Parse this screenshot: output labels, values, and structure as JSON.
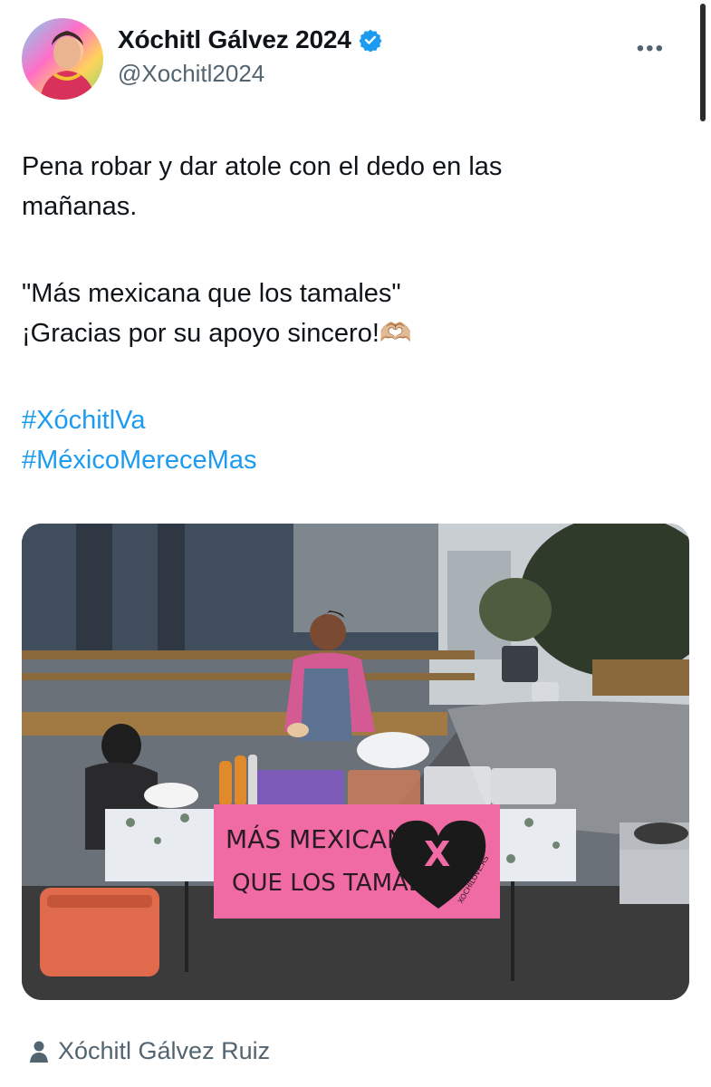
{
  "post": {
    "display_name": "Xóchitl Gálvez 2024",
    "handle": "@Xochitl2024",
    "more_icon": "more-icon",
    "verified_color": "#1d9bf0",
    "text_line1": "Pena robar y dar atole con el dedo en las",
    "text_line2": "mañanas.",
    "text_line3": "\"Más mexicana que los tamales\"",
    "text_line4": "¡Gracias por su apoyo sincero!🫶🏼",
    "hashtag1": "#XóchitlVa",
    "hashtag2": "#MéxicoMereceMas"
  },
  "media": {
    "banner_line1": "MÁS MEXICANA",
    "banner_line2": "QUE LOS TAMALES",
    "banner_mark": "X",
    "banner_site": "XOCHILOVE.RS"
  },
  "footer": {
    "author_label": "Xóchitl Gálvez Ruiz",
    "icon": "person-icon"
  },
  "colors": {
    "hashtag": "#1d9bf0",
    "secondary_text": "#536471",
    "banner_pink": "#f06aa3"
  }
}
